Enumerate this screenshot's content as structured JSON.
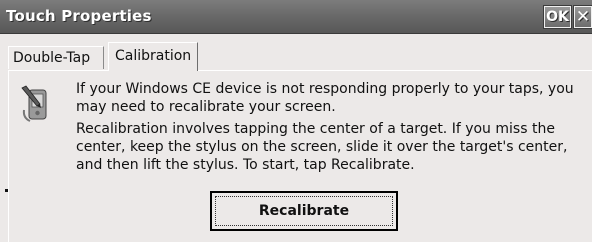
{
  "window": {
    "title": "Touch Properties",
    "ok_label": "OK",
    "close_label": "✕"
  },
  "tabs": [
    {
      "label": "Double-Tap",
      "active": false
    },
    {
      "label": "Calibration",
      "active": true
    }
  ],
  "calibration": {
    "icon": "stylus-device-icon",
    "message_1": "If your Windows CE device is not responding properly to your taps, you may need to recalibrate your screen.",
    "message_2": "Recalibration involves tapping the center of a target. If you miss the center, keep the stylus on the screen, slide it over the target's center, and then lift the stylus. To start, tap Recalibrate.",
    "button_label": "Recalibrate"
  },
  "colors": {
    "titlebar": "#6a6a6a",
    "window_bg": "#ece9e8",
    "title_text": "#ffffff"
  }
}
